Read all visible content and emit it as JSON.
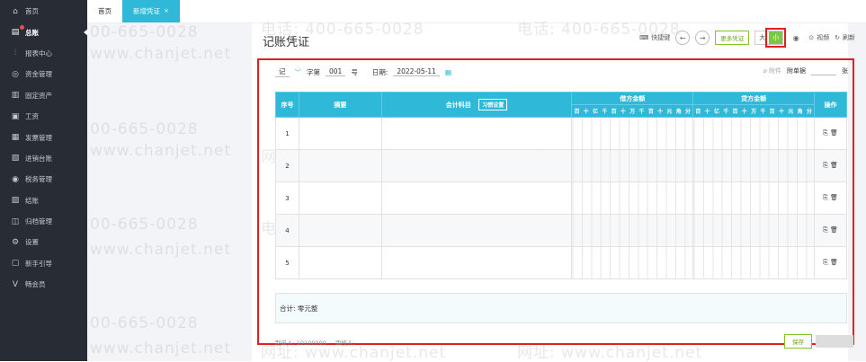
{
  "sidebar": {
    "items": [
      {
        "label": "首页",
        "icon": "home-icon",
        "glyph": "⌂"
      },
      {
        "label": "总账",
        "icon": "ledger-icon",
        "glyph": "▤"
      },
      {
        "label": "报表中心",
        "icon": "chart-icon",
        "glyph": "⫶"
      },
      {
        "label": "资金管理",
        "icon": "fund-icon",
        "glyph": "◎"
      },
      {
        "label": "固定资产",
        "icon": "asset-icon",
        "glyph": "▥"
      },
      {
        "label": "工资",
        "icon": "salary-icon",
        "glyph": "▣"
      },
      {
        "label": "发票管理",
        "icon": "invoice-icon",
        "glyph": "▦"
      },
      {
        "label": "进销台账",
        "icon": "inventory-icon",
        "glyph": "▧"
      },
      {
        "label": "税务管理",
        "icon": "tax-icon",
        "glyph": "◉"
      },
      {
        "label": "结账",
        "icon": "close-books-icon",
        "glyph": "▨"
      },
      {
        "label": "归档管理",
        "icon": "archive-icon",
        "glyph": "◫"
      },
      {
        "label": "设置",
        "icon": "gear-icon",
        "glyph": "⚙"
      },
      {
        "label": "新手引导",
        "icon": "guide-icon",
        "glyph": "▢"
      },
      {
        "label": "畅会员",
        "icon": "vip-icon",
        "glyph": "V"
      }
    ]
  },
  "tabs": [
    {
      "label": "首页"
    },
    {
      "label": "新增凭证",
      "close": "×"
    }
  ],
  "page": {
    "title": "记账凭证"
  },
  "toolbar": {
    "shortcut_label": "快捷键",
    "prev": "←",
    "next": "→",
    "more_label": "更多凭证",
    "size_large": "大",
    "size_small": "小",
    "eye": "◉",
    "video_label": "视频",
    "refresh_label": "刷新"
  },
  "voucher": {
    "type": "记",
    "word": "字第",
    "number": "001",
    "number_suffix": "号",
    "date_label": "日期:",
    "date_value": "2022-05-11",
    "attachment_label": "附件",
    "attachment_suffix": "附单据",
    "attachment_unit": "张"
  },
  "table": {
    "headers": {
      "seq": "序号",
      "summary": "摘要",
      "account": "会计科目",
      "habit_setting": "习惯设置",
      "debit": "借方金额",
      "credit": "贷方金额",
      "ops": "操作"
    },
    "digit_units": [
      "百",
      "十",
      "亿",
      "千",
      "百",
      "十",
      "万",
      "千",
      "百",
      "十",
      "元",
      "角",
      "分"
    ],
    "rows": [
      "1",
      "2",
      "3",
      "4",
      "5"
    ]
  },
  "total": {
    "label": "合计: 零元整"
  },
  "footer": {
    "maker": "制单人: 10100000",
    "reviewer": "审核人:",
    "save_label": "保存"
  },
  "watermarks": {
    "phone": "电话: 400-665-0028",
    "site": "网址: www.chanjet.net",
    "phone_short": "00-665-0028",
    "site_short": "www.chanjet.net"
  },
  "colors": {
    "sidebar_bg": "#272c35",
    "accent": "#2fb8d8",
    "green": "#7ac943",
    "highlight": "#e02020"
  }
}
